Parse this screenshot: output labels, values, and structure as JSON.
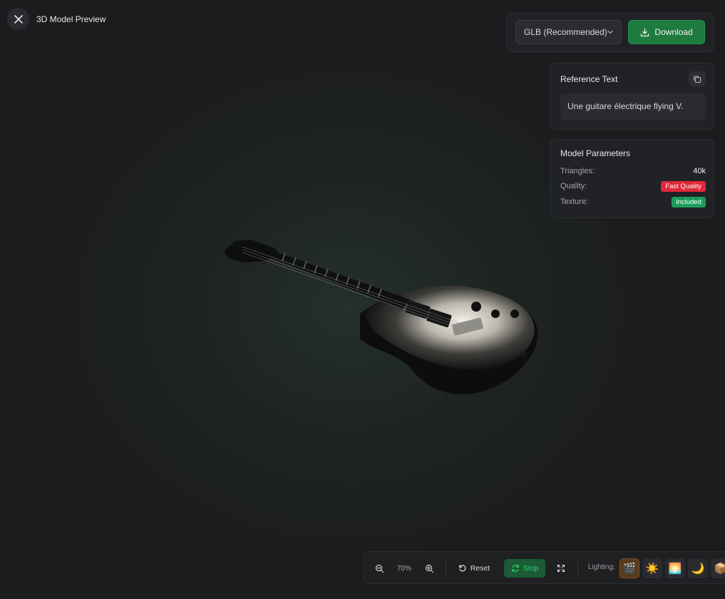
{
  "header": {
    "title": "3D Model Preview"
  },
  "export": {
    "format_selected": "GLB (Recommended)",
    "download_label": "Download"
  },
  "reference": {
    "title": "Reference Text",
    "text": "Une guitare électrique flying V."
  },
  "params": {
    "title": "Model Parameters",
    "rows": [
      {
        "label": "Triangles:",
        "value": "40k"
      },
      {
        "label": "Quality:",
        "value": "Fast Quality"
      },
      {
        "label": "Texture:",
        "value": "Included"
      }
    ]
  },
  "toolbar": {
    "zoom": "70%",
    "reset_label": "Reset",
    "stop_label": "Stop",
    "lighting_label": "Lighting:",
    "lighting_presets": [
      "🎬",
      "☀️",
      "🌅",
      "🌙",
      "📦"
    ]
  },
  "colors": {
    "accent_green": "#1f7a3f",
    "badge_red": "#e0283a",
    "badge_green": "#1a9e5a",
    "active_light": "#5a3a1c"
  }
}
